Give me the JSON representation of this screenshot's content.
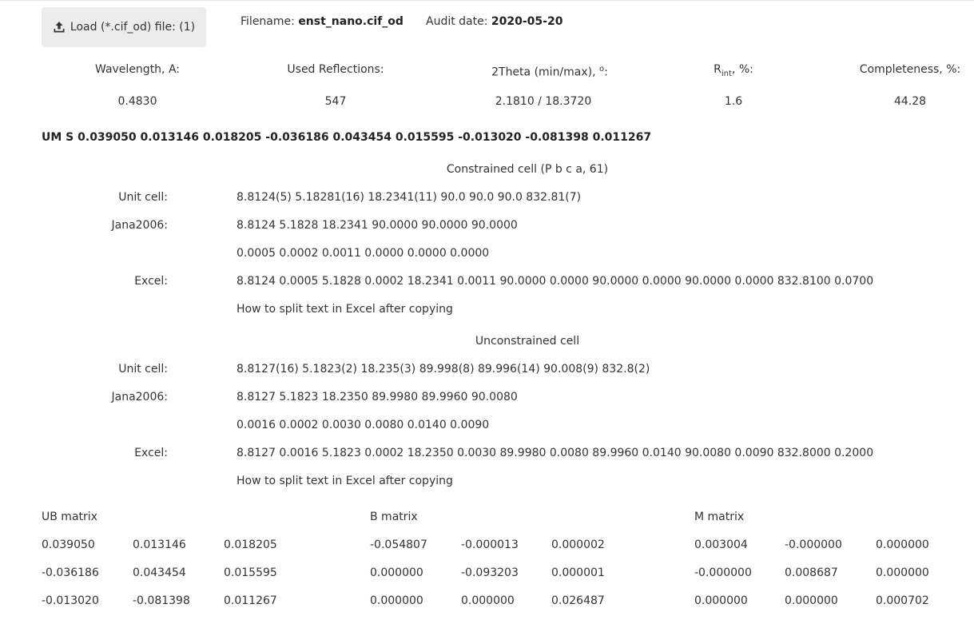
{
  "load": {
    "label": "Load (*.cif_od) file: (1)"
  },
  "file": {
    "filename_label": "Filename:",
    "filename": "enst_nano.cif_od",
    "audit_label": "Audit date:",
    "audit_date": "2020-05-20"
  },
  "stats": {
    "wavelength_label": "Wavelength, A:",
    "wavelength": "0.4830",
    "reflections_label": "Used Reflections:",
    "reflections": "547",
    "theta_label": "2Theta (min/max), ",
    "theta_unit": "o",
    "theta_colon": ":",
    "theta": "2.1810 / 18.3720",
    "rint_R": "R",
    "rint_sub": "int",
    "rint_rest": ", %:",
    "rint": "1.6",
    "completeness_label": "Completeness, %:",
    "completeness": "44.28"
  },
  "um": "UM S 0.039050 0.013146 0.018205 -0.036186 0.043454 0.015595 -0.013020 -0.081398 0.011267",
  "constrained": {
    "title": "Constrained cell (P b c a, 61)",
    "unit_cell_label": "Unit cell:",
    "unit_cell": "8.8124(5) 5.18281(16) 18.2341(11) 90.0 90.0 90.0 832.81(7)",
    "jana_label": "Jana2006:",
    "jana": "8.8124 5.1828 18.2341 90.0000 90.0000 90.0000",
    "jana_err": "0.0005 0.0002 0.0011 0.0000 0.0000 0.0000",
    "excel_label": "Excel:",
    "excel": "8.8124 0.0005 5.1828 0.0002 18.2341 0.0011 90.0000 0.0000 90.0000 0.0000 90.0000 0.0000 832.8100 0.0700",
    "split_link": "How to split text in Excel after copying"
  },
  "unconstrained": {
    "title": "Unconstrained cell",
    "unit_cell_label": "Unit cell:",
    "unit_cell": "8.8127(16) 5.1823(2) 18.235(3) 89.998(8) 89.996(14) 90.008(9) 832.8(2)",
    "jana_label": "Jana2006:",
    "jana": "8.8127 5.1823 18.2350 89.9980 89.9960 90.0080",
    "jana_err": "0.0016 0.0002 0.0030 0.0080 0.0140 0.0090",
    "excel_label": "Excel:",
    "excel": "8.8127 0.0016 5.1823 0.0002 18.2350 0.0030 89.9980 0.0080 89.9960 0.0140 90.0080 0.0090 832.8000 0.2000",
    "split_link": "How to split text in Excel after copying"
  },
  "matrices": {
    "ub": {
      "title": "UB matrix",
      "rows": [
        [
          "0.039050",
          "0.013146",
          "0.018205"
        ],
        [
          "-0.036186",
          "0.043454",
          "0.015595"
        ],
        [
          "-0.013020",
          "-0.081398",
          "0.011267"
        ]
      ]
    },
    "b": {
      "title": "B matrix",
      "rows": [
        [
          "-0.054807",
          "-0.000013",
          "0.000002"
        ],
        [
          "0.000000",
          "-0.093203",
          "0.000001"
        ],
        [
          "0.000000",
          "0.000000",
          "0.026487"
        ]
      ]
    },
    "m": {
      "title": "M matrix",
      "rows": [
        [
          "0.003004",
          "-0.000000",
          "0.000000"
        ],
        [
          "-0.000000",
          "0.008687",
          "0.000000"
        ],
        [
          "0.000000",
          "0.000000",
          "0.000702"
        ]
      ]
    }
  }
}
